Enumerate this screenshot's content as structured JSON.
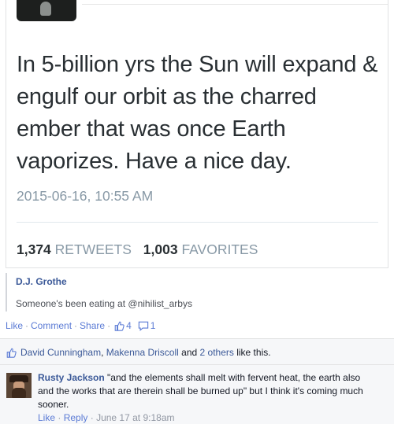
{
  "tweet": {
    "text": "In 5-billion yrs the Sun will expand & engulf our orbit as the charred ember that was once Earth vaporizes. Have a nice day.",
    "timestamp": "2015-06-16, 10:55 AM",
    "retweets_count": "1,374",
    "retweets_label": "RETWEETS",
    "favorites_count": "1,003",
    "favorites_label": "FAVORITES"
  },
  "shared_post": {
    "author": "D.J. Grothe",
    "text": "Someone's been eating at @nihilist_arbys"
  },
  "post_actions": {
    "like": "Like",
    "comment": "Comment",
    "share": "Share",
    "likes_count": "4",
    "comments_count": "1"
  },
  "likes_summary": {
    "user1": "David Cunningham",
    "separator": ",",
    "user2": "Makenna Driscoll",
    "and": "and",
    "others": "2 others",
    "suffix": "like this."
  },
  "comment": {
    "author": "Rusty Jackson",
    "text": "\"and the elements shall melt with fervent heat, the earth also and the works that are therein shall be burned up\" but I think it's coming much sooner.",
    "like": "Like",
    "reply": "Reply",
    "date": "June 17 at 9:18am"
  },
  "colors": {
    "link": "#3b5998",
    "action_link": "#5b7bd5",
    "muted": "#9197a3",
    "tweet_muted": "#8899a6"
  },
  "icons": [
    "thumbs-up-icon",
    "comment-bubble-icon"
  ]
}
